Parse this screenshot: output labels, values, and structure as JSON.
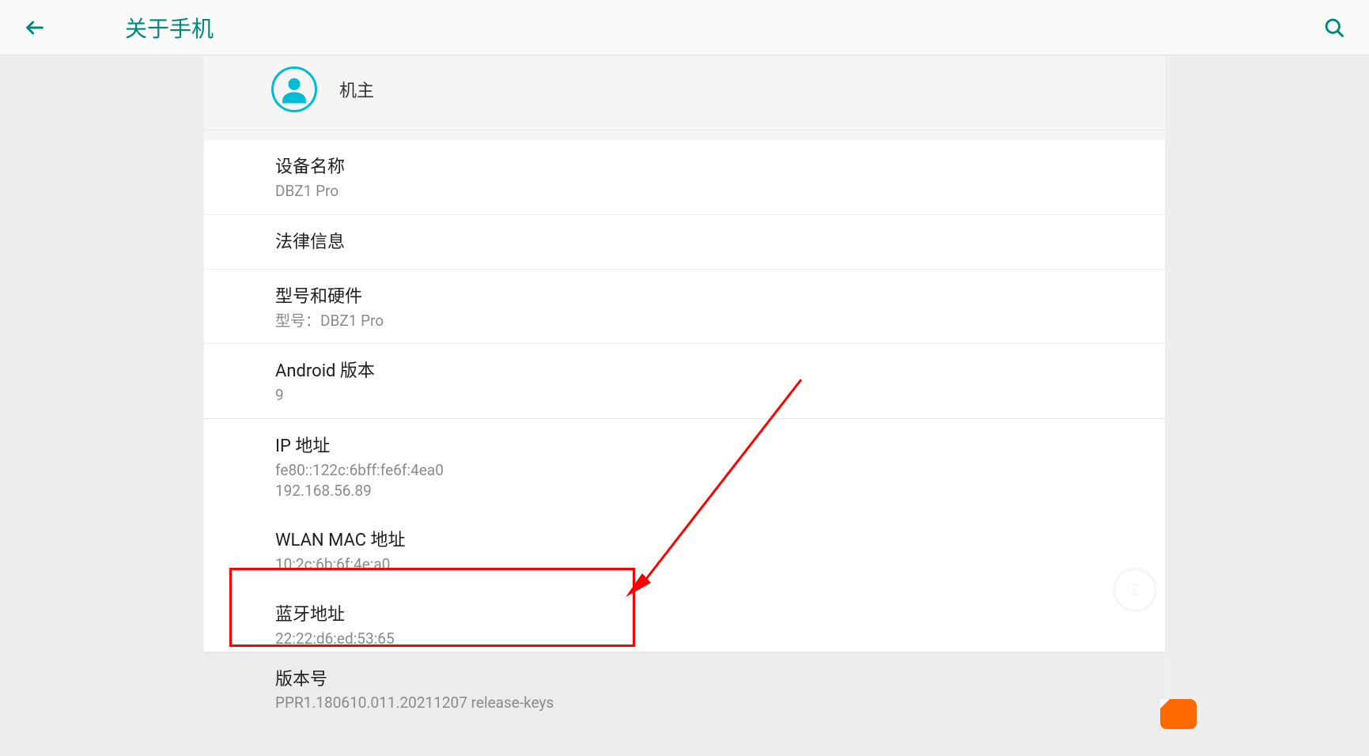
{
  "header": {
    "title": "关于手机"
  },
  "owner": {
    "label": "机主"
  },
  "items": {
    "device_name": {
      "title": "设备名称",
      "value": "DBZ1 Pro"
    },
    "legal": {
      "title": "法律信息"
    },
    "model": {
      "title": "型号和硬件",
      "value": "型号：DBZ1 Pro"
    },
    "android": {
      "title": "Android 版本",
      "value": "9"
    },
    "ip": {
      "title": "IP 地址",
      "v1": "fe80::122c:6bff:fe6f:4ea0",
      "v2": "192.168.56.89"
    },
    "wlan": {
      "title": "WLAN MAC 地址",
      "value": "10:2c:6b:6f:4e:a0"
    },
    "bt": {
      "title": "蓝牙地址",
      "value": "22:22:d6:ed:53:65"
    },
    "build": {
      "title": "版本号",
      "value": "PPR1.180610.011.20211207 release-keys"
    }
  },
  "colors": {
    "accent": "#00897b",
    "annotation": "#ff0000"
  }
}
